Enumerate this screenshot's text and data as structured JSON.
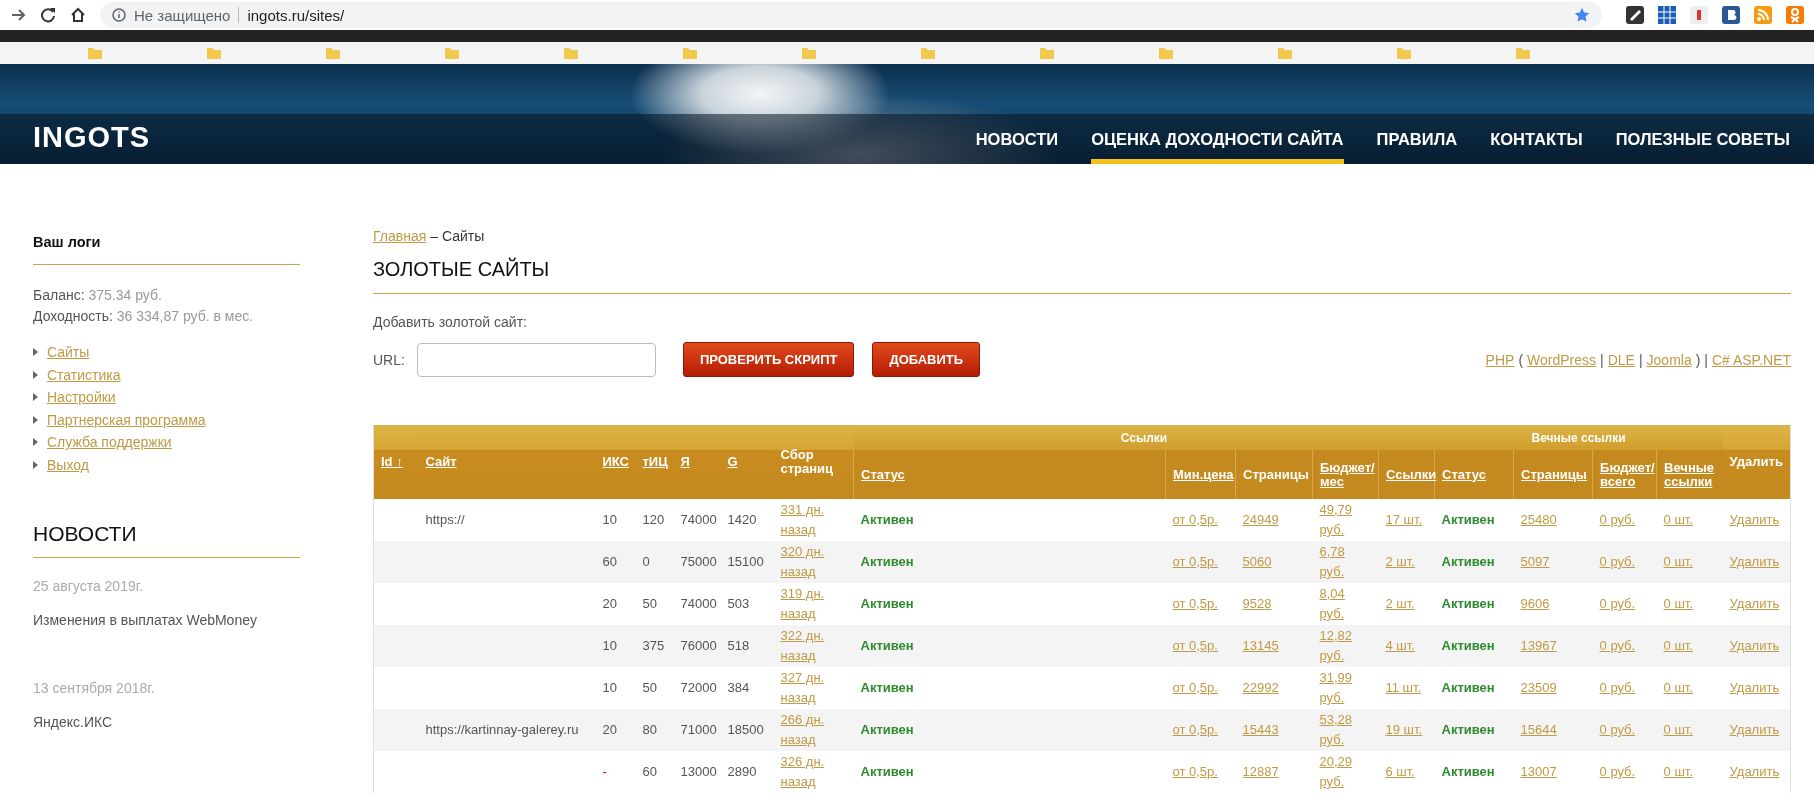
{
  "browser": {
    "security": "Не защищено",
    "url": "ingots.ru/sites/"
  },
  "header": {
    "logo": "INGOTS",
    "nav": [
      {
        "label": "НОВОСТИ",
        "selected": false
      },
      {
        "label": "ОЦЕНКА ДОХОДНОСТИ САЙТА",
        "selected": true
      },
      {
        "label": "ПРАВИЛА",
        "selected": false
      },
      {
        "label": "КОНТАКТЫ",
        "selected": false
      },
      {
        "label": "ПОЛЕЗНЫЕ СОВЕТЫ",
        "selected": false
      }
    ]
  },
  "sidebar": {
    "login": "Ваш логи",
    "stats": [
      {
        "label": "Баланс:",
        "value": "375.34 руб."
      },
      {
        "label": "Доходность:",
        "value": "36 334,87 руб. в мес."
      }
    ],
    "menu": [
      "Сайты",
      "Статистика",
      "Настройки",
      "Партнерская программа",
      "Служба поддержки",
      "Выход"
    ],
    "news_title": "НОВОСТИ",
    "news": [
      {
        "date": "25 августа 2019г.",
        "title": "Изменения в выплатах WebMoney"
      },
      {
        "date": "13 сентября 2018г.",
        "title": "Яндекс.ИКС"
      }
    ]
  },
  "main": {
    "breadcrumb": {
      "link": "Главная",
      "separator": "–",
      "current": "Сайты"
    },
    "title": "ЗОЛОТЫЕ САЙТЫ",
    "add_label": "Добавить золотой сайт:",
    "url_label": "URL:",
    "buttons": [
      "ПРОВЕРИТЬ СКРИПТ",
      "ДОБАВИТЬ"
    ],
    "script_links": [
      {
        "text": "PHP",
        "kind": "link"
      },
      {
        "text": "(",
        "kind": "plain"
      },
      {
        "text": "WordPress",
        "kind": "link"
      },
      {
        "text": "|",
        "kind": "plain"
      },
      {
        "text": "DLE",
        "kind": "link"
      },
      {
        "text": "|",
        "kind": "plain"
      },
      {
        "text": "Joomla",
        "kind": "link"
      },
      {
        "text": ") |",
        "kind": "plain"
      },
      {
        "text": "C# ASP.NET",
        "kind": "link"
      }
    ]
  },
  "table": {
    "column_groups": [
      {
        "columns": [
          {
            "label": "Id ↑",
            "sortable": true
          },
          {
            "label": "Сайт",
            "sortable": true
          },
          {
            "label": "ИКС",
            "sortable": true
          },
          {
            "label": "тИЦ",
            "sortable": true
          },
          {
            "label": "Я",
            "sortable": true
          },
          {
            "label": "G",
            "sortable": true
          },
          {
            "label": "Сбор страниц",
            "sortable": false
          }
        ]
      },
      {
        "label": "Ссылки",
        "columns": [
          {
            "label": "Статус",
            "sortable": true
          },
          {
            "label": "Мин.цена",
            "sortable": true
          },
          {
            "label": "Страницы",
            "sortable": false
          },
          {
            "label": "Бюджет/ мес",
            "sortable": true
          },
          {
            "label": "Ссылки",
            "sortable": true
          }
        ]
      },
      {
        "label": "Вечные ссылки",
        "columns": [
          {
            "label": "Статус",
            "sortable": true
          },
          {
            "label": "Страницы",
            "sortable": true
          },
          {
            "label": "Бюджет/ всего",
            "sortable": true
          },
          {
            "label": "Вечные ссылки",
            "sortable": true
          }
        ]
      },
      {
        "columns": [
          {
            "label": "Удалить",
            "sortable": false
          }
        ]
      }
    ],
    "rows": [
      {
        "site": "https://",
        "iks": "10",
        "iks_unset": false,
        "tic": "120",
        "ya": "74000",
        "g": "1420",
        "collected": "331 дн. назад",
        "status": "Активен",
        "min_price": "от 0,5р.",
        "pages": "24949",
        "budget": "49,79 руб.",
        "links": "17 шт.",
        "eternal_status": "Активен",
        "eternal_pages": "25480",
        "budget_total": "0 руб.",
        "eternal_links": "0 шт.",
        "delete": "Удалить"
      },
      {
        "iks": "60",
        "iks_unset": false,
        "tic": "0",
        "ya": "75000",
        "g": "15100",
        "collected": "320 дн. назад",
        "status": "Активен",
        "min_price": "от 0,5р.",
        "pages": "5060",
        "budget": "6,78 руб.",
        "links": "2 шт.",
        "eternal_status": "Активен",
        "eternal_pages": "5097",
        "budget_total": "0 руб.",
        "eternal_links": "0 шт.",
        "delete": "Удалить"
      },
      {
        "iks": "20",
        "iks_unset": false,
        "tic": "50",
        "ya": "74000",
        "g": "503",
        "collected": "319 дн. назад",
        "status": "Активен",
        "min_price": "от 0,5р.",
        "pages": "9528",
        "budget": "8,04 руб.",
        "links": "2 шт.",
        "eternal_status": "Активен",
        "eternal_pages": "9606",
        "budget_total": "0 руб.",
        "eternal_links": "0 шт.",
        "delete": "Удалить"
      },
      {
        "iks": "10",
        "iks_unset": false,
        "tic": "375",
        "ya": "76000",
        "g": "518",
        "collected": "322 дн. назад",
        "status": "Активен",
        "min_price": "от 0,5р.",
        "pages": "13145",
        "budget": "12,82 руб.",
        "links": "4 шт.",
        "eternal_status": "Активен",
        "eternal_pages": "13967",
        "budget_total": "0 руб.",
        "eternal_links": "0 шт.",
        "delete": "Удалить"
      },
      {
        "iks": "10",
        "iks_unset": false,
        "tic": "50",
        "ya": "72000",
        "g": "384",
        "collected": "327 дн. назад",
        "status": "Активен",
        "min_price": "от 0,5р.",
        "pages": "22992",
        "budget": "31,99 руб.",
        "links": "11 шт.",
        "eternal_status": "Активен",
        "eternal_pages": "23509",
        "budget_total": "0 руб.",
        "eternal_links": "0 шт.",
        "delete": "Удалить"
      },
      {
        "site": "https://kartinnay-galerey.ru",
        "iks": "20",
        "iks_unset": false,
        "tic": "80",
        "ya": "71000",
        "g": "18500",
        "collected": "266 дн. назад",
        "status": "Активен",
        "min_price": "от 0,5р.",
        "pages": "15443",
        "budget": "53,28 руб.",
        "links": "19 шт.",
        "eternal_status": "Активен",
        "eternal_pages": "15644",
        "budget_total": "0 руб.",
        "eternal_links": "0 шт.",
        "delete": "Удалить"
      },
      {
        "iks": "-",
        "iks_unset": true,
        "tic": "60",
        "ya": "13000",
        "g": "2890",
        "collected": "326 дн. назад",
        "status": "Активен",
        "min_price": "от 0,5р.",
        "pages": "12887",
        "budget": "20,29 руб.",
        "links": "6 шт.",
        "eternal_status": "Активен",
        "eternal_pages": "13007",
        "budget_total": "0 руб.",
        "eternal_links": "0 шт.",
        "delete": "Удалить"
      }
    ]
  }
}
